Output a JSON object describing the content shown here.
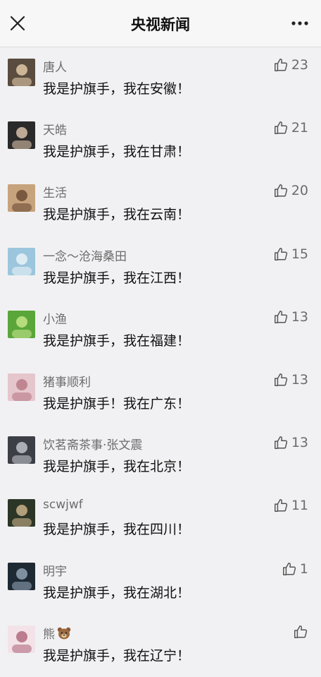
{
  "header": {
    "title": "央视新闻",
    "close_icon": "close-icon",
    "more_icon": "more-icon"
  },
  "comments": [
    {
      "name": "唐人",
      "text": "我是护旗手，我在安徽！",
      "likes": "23",
      "avatar_color": "#5a4c3f",
      "avatar_accent": "#e0c9a6"
    },
    {
      "name": "天皓",
      "text": "我是护旗手，我在甘肃！",
      "likes": "21",
      "avatar_color": "#2a2a2a",
      "avatar_accent": "#d8c0a8"
    },
    {
      "name": "生活",
      "text": "我是护旗手，我在云南！",
      "likes": "20",
      "avatar_color": "#c7a37d",
      "avatar_accent": "#6b4b34"
    },
    {
      "name": "一念～沧海桑田",
      "text": "我是护旗手，我在江西！",
      "likes": "15",
      "avatar_color": "#9cc6dd",
      "avatar_accent": "#e9f2f7"
    },
    {
      "name": "小渔",
      "text": "我是护旗手，我在福建！",
      "likes": "13",
      "avatar_color": "#5aa63a",
      "avatar_accent": "#c4e58c"
    },
    {
      "name": "猪事顺利",
      "text": "我是护旗手！我在广东！",
      "likes": "13",
      "avatar_color": "#e6c6cd",
      "avatar_accent": "#b77a86"
    },
    {
      "name": "饮茗斋茶事·张文震",
      "text": "我是护旗手，我在北京！",
      "likes": "13",
      "avatar_color": "#3d3f46",
      "avatar_accent": "#bfc2ca"
    },
    {
      "name": "scwjwf",
      "text": "我是护旗手，我在四川！",
      "likes": "11",
      "avatar_color": "#2c3626",
      "avatar_accent": "#c9b08a"
    },
    {
      "name": "明宇",
      "text": "我是护旗手，我在湖北！",
      "likes": "1",
      "avatar_color": "#1e2a33",
      "avatar_accent": "#8fa2b3"
    },
    {
      "name": "熊",
      "text": "我是护旗手，我在辽宁！",
      "likes": "",
      "avatar_color": "#f3e3e8",
      "avatar_accent": "#b06a80",
      "name_emoji": "bear-emoji"
    }
  ]
}
